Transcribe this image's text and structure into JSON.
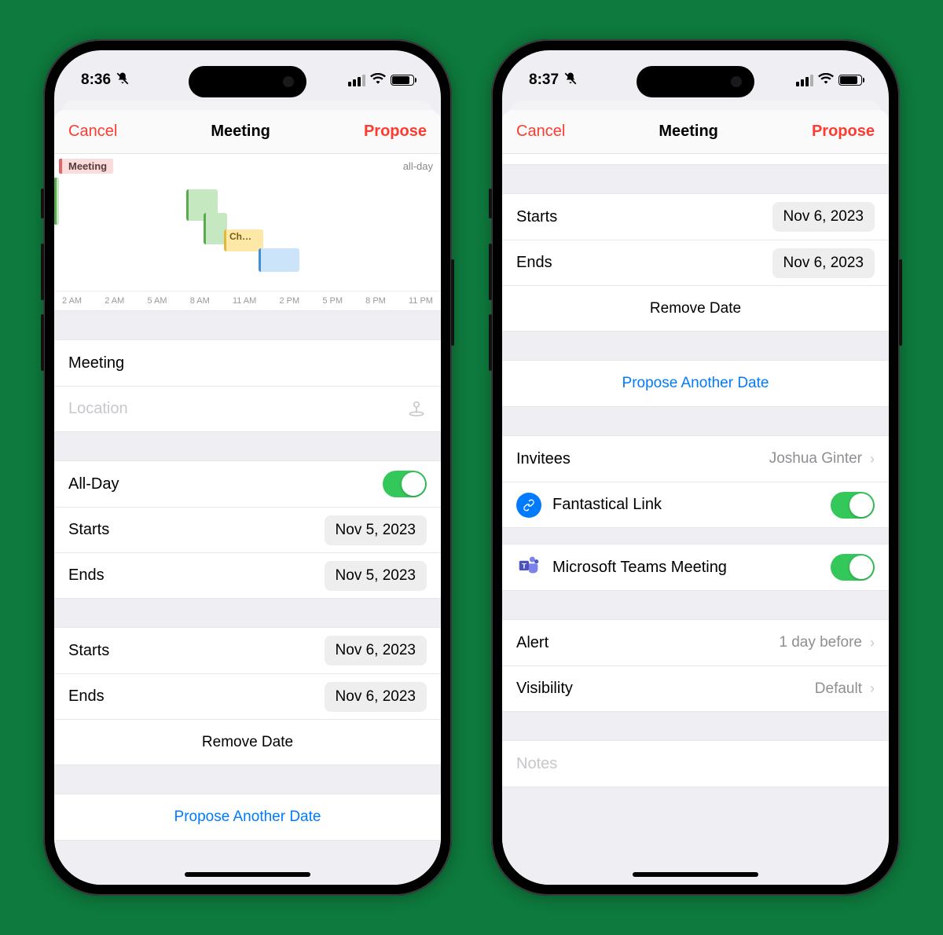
{
  "left": {
    "status_time": "8:36",
    "nav": {
      "cancel": "Cancel",
      "title": "Meeting",
      "propose": "Propose"
    },
    "timeline": {
      "allday_event": "Meeting",
      "allday_label": "all-day",
      "yellow_event": "Ch…",
      "ticks": [
        "2 AM",
        "2 AM",
        "5 AM",
        "8 AM",
        "11 AM",
        "2 PM",
        "5 PM",
        "8 PM",
        "11 PM"
      ]
    },
    "title_field": "Meeting",
    "location_placeholder": "Location",
    "allday_label": "All-Day",
    "allday_on": true,
    "block1": {
      "starts_label": "Starts",
      "starts_value": "Nov 5, 2023",
      "ends_label": "Ends",
      "ends_value": "Nov 5, 2023"
    },
    "block2": {
      "starts_label": "Starts",
      "starts_value": "Nov 6, 2023",
      "ends_label": "Ends",
      "ends_value": "Nov 6, 2023"
    },
    "remove_date": "Remove Date",
    "propose_another": "Propose Another Date"
  },
  "right": {
    "status_time": "8:37",
    "nav": {
      "cancel": "Cancel",
      "title": "Meeting",
      "propose": "Propose"
    },
    "block": {
      "starts_label": "Starts",
      "starts_value": "Nov 6, 2023",
      "ends_label": "Ends",
      "ends_value": "Nov 6, 2023"
    },
    "remove_date": "Remove Date",
    "propose_another": "Propose Another Date",
    "invitees_label": "Invitees",
    "invitees_value": "Joshua Ginter",
    "fantastical_label": "Fantastical Link",
    "fantastical_on": true,
    "teams_label": "Microsoft Teams Meeting",
    "teams_on": true,
    "alert_label": "Alert",
    "alert_value": "1 day before",
    "visibility_label": "Visibility",
    "visibility_value": "Default",
    "notes_placeholder": "Notes"
  }
}
